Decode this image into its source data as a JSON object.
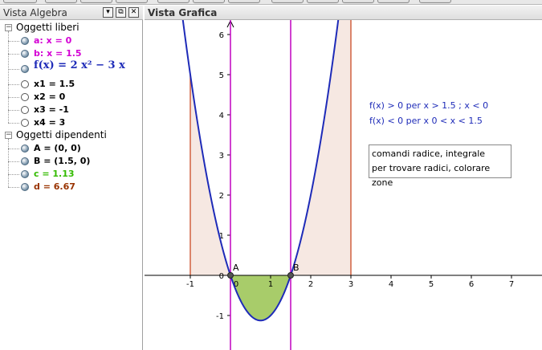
{
  "algebra": {
    "title": "Vista Algebra",
    "buttons": [
      "▾",
      "⧉",
      "✕"
    ],
    "groups": [
      {
        "label": "Oggetti liberi",
        "items": [
          {
            "text": "a: x = 0",
            "color": "#d400d4",
            "visible": true
          },
          {
            "text": "b: x = 1.5",
            "color": "#d400d4",
            "visible": true
          },
          {
            "text": "f(x) = 2 x² − 3 x",
            "color": "#1e2bb8",
            "visible": true,
            "math": true
          },
          {
            "text": "x1 = 1.5",
            "color": "#000000",
            "visible": false
          },
          {
            "text": "x2 = 0",
            "color": "#000000",
            "visible": false
          },
          {
            "text": "x3 = -1",
            "color": "#000000",
            "visible": false
          },
          {
            "text": "x4 = 3",
            "color": "#000000",
            "visible": false
          }
        ]
      },
      {
        "label": "Oggetti dipendenti",
        "items": [
          {
            "text": "A = (0, 0)",
            "color": "#000000",
            "visible": true
          },
          {
            "text": "B = (1.5, 0)",
            "color": "#000000",
            "visible": true
          },
          {
            "text": "c = 1.13",
            "color": "#33bb00",
            "visible": true
          },
          {
            "text": "d = 6.67",
            "color": "#993300",
            "visible": true
          }
        ]
      }
    ]
  },
  "graphics": {
    "title": "Vista Grafica",
    "annotation1": "f(x) > 0 per x > 1.5 ; x < 0",
    "annotation2": "f(x) < 0 per x 0 < x < 1.5",
    "note_line1": "comandi radice, integrale",
    "note_line2": "per trovare radici, colorare zone",
    "point_a_label": "A",
    "point_b_label": "B"
  },
  "chart_data": {
    "type": "line",
    "function": "f(x) = 2x^2 - 3x",
    "xlim": [
      -2,
      7.8
    ],
    "ylim": [
      -1.75,
      6.5
    ],
    "x_ticks": [
      -1,
      0,
      1,
      2,
      3,
      4,
      5,
      6,
      7
    ],
    "y_ticks": [
      -1,
      0,
      1,
      2,
      3,
      4,
      5,
      6
    ],
    "vertical_lines": [
      0,
      1.5
    ],
    "positive_shaded": [
      [
        -1,
        0
      ],
      [
        1.5,
        3
      ]
    ],
    "negative_shaded": [
      0,
      1.5
    ],
    "points": [
      {
        "name": "A",
        "x": 0,
        "y": 0
      },
      {
        "name": "B",
        "x": 1.5,
        "y": 0
      }
    ],
    "colors": {
      "curve": "#1e2bb8",
      "vertical_lines": "#c000c0",
      "positive_fill": "#f6e8e2",
      "positive_border": "#d06040",
      "negative_fill": "#a8cc6a",
      "negative_border": "#557a22"
    }
  }
}
